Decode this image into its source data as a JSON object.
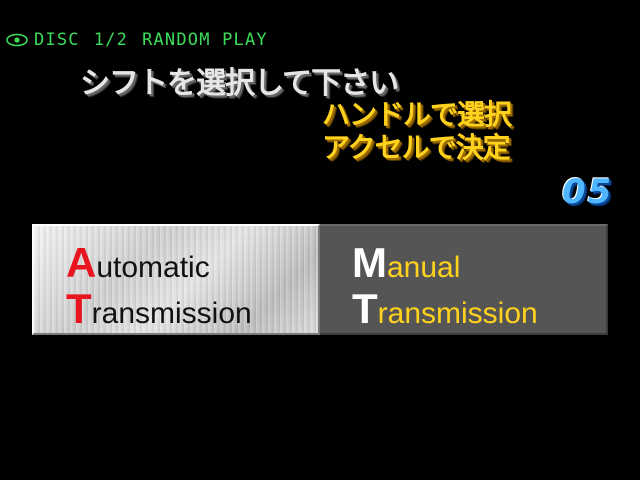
{
  "status_bar": {
    "icon": "disc-eye-icon",
    "disc_label": "DISC",
    "disc_index": "1/2",
    "mode": "RANDOM PLAY",
    "color": "#3cdc5a"
  },
  "instructions": {
    "main": "シフトを選択して下さい",
    "steer": "ハンドルで選択",
    "accel": "アクセルで決定"
  },
  "countdown": "05",
  "choices": {
    "automatic": {
      "line1_cap": "A",
      "line1_rest": "utomatic",
      "line2_cap": "T",
      "line2_rest": "ransmission",
      "selected": true
    },
    "manual": {
      "line1_cap": "M",
      "line1_rest": "anual",
      "line2_cap": "T",
      "line2_rest": "ransmission",
      "selected": false
    }
  },
  "colors": {
    "background": "#000000",
    "instruction_main": "#e6e6e6",
    "instruction_sub": "#ffd21e",
    "countdown": "#4fb6ff",
    "at_capital": "#e8141e",
    "mt_text": "#ffd21e"
  }
}
